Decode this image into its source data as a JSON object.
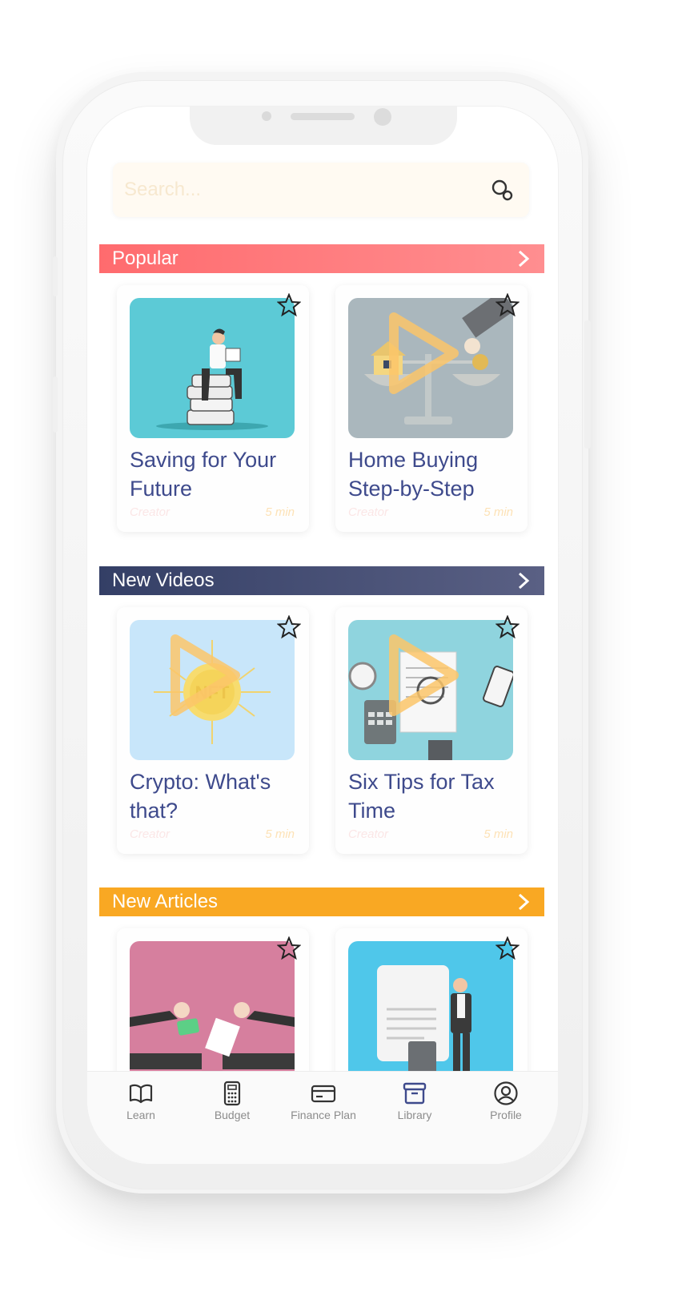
{
  "search": {
    "placeholder": "Search..."
  },
  "sections": [
    {
      "title": "Popular",
      "cards": [
        {
          "title": "Saving for Your Future",
          "creator": "Creator",
          "duration": "5 min",
          "type": "article"
        },
        {
          "title": "Home Buying Step-by-Step",
          "creator": "Creator",
          "duration": "5 min",
          "type": "video"
        }
      ]
    },
    {
      "title": "New Videos",
      "cards": [
        {
          "title": "Crypto: What's that?",
          "creator": "Creator",
          "duration": "5 min",
          "type": "video"
        },
        {
          "title": "Six Tips for Tax Time",
          "creator": "Creator",
          "duration": "5 min",
          "type": "video"
        }
      ]
    },
    {
      "title": "New Articles",
      "cards": [
        {
          "title": "",
          "creator": "",
          "duration": "",
          "type": "article"
        },
        {
          "title": "",
          "creator": "",
          "duration": "",
          "type": "article"
        }
      ]
    }
  ],
  "tabs": [
    {
      "label": "Learn",
      "icon": "book-icon"
    },
    {
      "label": "Budget",
      "icon": "calculator-icon"
    },
    {
      "label": "Finance Plan",
      "icon": "credit-card-icon"
    },
    {
      "label": "Library",
      "icon": "archive-box-icon",
      "active": true
    },
    {
      "label": "Profile",
      "icon": "user-circle-icon"
    }
  ],
  "colors": {
    "popular_bar": "#ff6b6e",
    "videos_bar": "#343f66",
    "articles_bar": "#f9a823",
    "card_title": "#3e4a8c",
    "library_active": "#3e4a8c"
  }
}
